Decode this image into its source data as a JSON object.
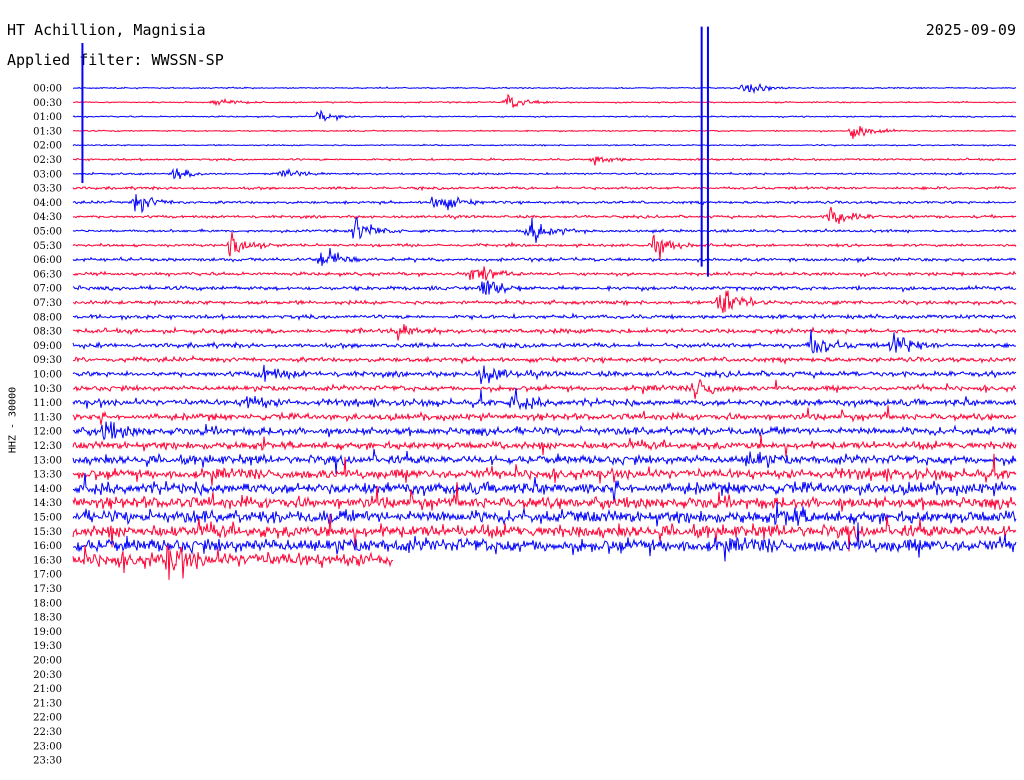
{
  "header": {
    "station": "HT Achillion, Magnisia",
    "date": "2025-09-09",
    "filter": "Applied filter: WWSSN-SP"
  },
  "chart_data": {
    "type": "line",
    "title": "HT Achillion, Magnisia",
    "ylabel": "HHZ - 30000",
    "xlim": [
      0,
      30
    ],
    "row_labels": [
      "00:00",
      "00:30",
      "01:00",
      "01:30",
      "02:00",
      "02:30",
      "03:00",
      "03:30",
      "04:00",
      "04:30",
      "05:00",
      "05:30",
      "06:00",
      "06:30",
      "07:00",
      "07:30",
      "08:00",
      "08:30",
      "09:00",
      "09:30",
      "10:00",
      "10:30",
      "11:00",
      "11:30",
      "12:00",
      "12:30",
      "13:00",
      "13:30",
      "14:00",
      "14:30",
      "15:00",
      "15:30",
      "16:00",
      "16:30",
      "17:00",
      "17:30",
      "18:00",
      "18:30",
      "19:00",
      "19:30",
      "20:00",
      "20:30",
      "21:00",
      "21:30",
      "22:00",
      "22:30",
      "23:00",
      "23:30"
    ],
    "colors": [
      "#0000ff",
      "#ff0033"
    ],
    "recorded_rows": 34,
    "last_row_end_fraction": 0.34,
    "noise_amplitude": [
      1,
      1,
      1,
      1,
      1,
      1.5,
      1.5,
      2,
      2,
      2,
      2,
      2,
      2.5,
      2.5,
      3,
      3,
      3,
      3.5,
      3.5,
      3.5,
      4,
      4,
      5,
      5,
      6,
      6,
      7,
      8,
      9,
      9,
      10,
      10,
      11,
      12
    ],
    "events": [
      {
        "row": 0,
        "minute": 21.3,
        "amp": 14
      },
      {
        "row": 1,
        "minute": 13.8,
        "amp": 16
      },
      {
        "row": 1,
        "minute": 4.5,
        "amp": 10
      },
      {
        "row": 2,
        "minute": 7.8,
        "amp": 10
      },
      {
        "row": 3,
        "minute": 24.8,
        "amp": 18
      },
      {
        "row": 5,
        "minute": 16.6,
        "amp": 10
      },
      {
        "row": 6,
        "minute": 3.2,
        "amp": 12
      },
      {
        "row": 6,
        "minute": 6.7,
        "amp": 10
      },
      {
        "row": 8,
        "minute": 2.0,
        "amp": 20
      },
      {
        "row": 8,
        "minute": 11.5,
        "amp": 26
      },
      {
        "row": 9,
        "minute": 24.1,
        "amp": 24
      },
      {
        "row": 10,
        "minute": 9.0,
        "amp": 28
      },
      {
        "row": 10,
        "minute": 14.5,
        "amp": 30
      },
      {
        "row": 11,
        "minute": 5.0,
        "amp": 26
      },
      {
        "row": 11,
        "minute": 18.5,
        "amp": 22
      },
      {
        "row": 12,
        "minute": 7.9,
        "amp": 26
      },
      {
        "row": 13,
        "minute": 12.7,
        "amp": 22
      },
      {
        "row": 14,
        "minute": 13.0,
        "amp": 26
      },
      {
        "row": 15,
        "minute": 20.6,
        "amp": 30
      },
      {
        "row": 17,
        "minute": 10.3,
        "amp": 16
      },
      {
        "row": 18,
        "minute": 23.5,
        "amp": 24
      },
      {
        "row": 18,
        "minute": 26.1,
        "amp": 24
      },
      {
        "row": 20,
        "minute": 6.0,
        "amp": 18
      },
      {
        "row": 20,
        "minute": 13.0,
        "amp": 20
      },
      {
        "row": 21,
        "minute": 19.8,
        "amp": 22
      },
      {
        "row": 22,
        "minute": 5.5,
        "amp": 20
      },
      {
        "row": 22,
        "minute": 14.0,
        "amp": 16
      },
      {
        "row": 24,
        "minute": 1.0,
        "amp": 18
      },
      {
        "row": 26,
        "minute": 21.5,
        "amp": 14
      },
      {
        "row": 30,
        "minute": 22.7,
        "amp": 14
      },
      {
        "row": 33,
        "minute": 3.0,
        "amp": 24
      },
      {
        "row": 33,
        "minute": 20.2,
        "amp": 30
      }
    ],
    "spikes": [
      {
        "row": 2,
        "minute": 20.0,
        "up": 90,
        "down": 150
      },
      {
        "row": 2,
        "minute": 20.2,
        "up": 90,
        "down": 160
      },
      {
        "row": 0,
        "minute": 0.3,
        "up": 45,
        "down": 95
      }
    ]
  }
}
